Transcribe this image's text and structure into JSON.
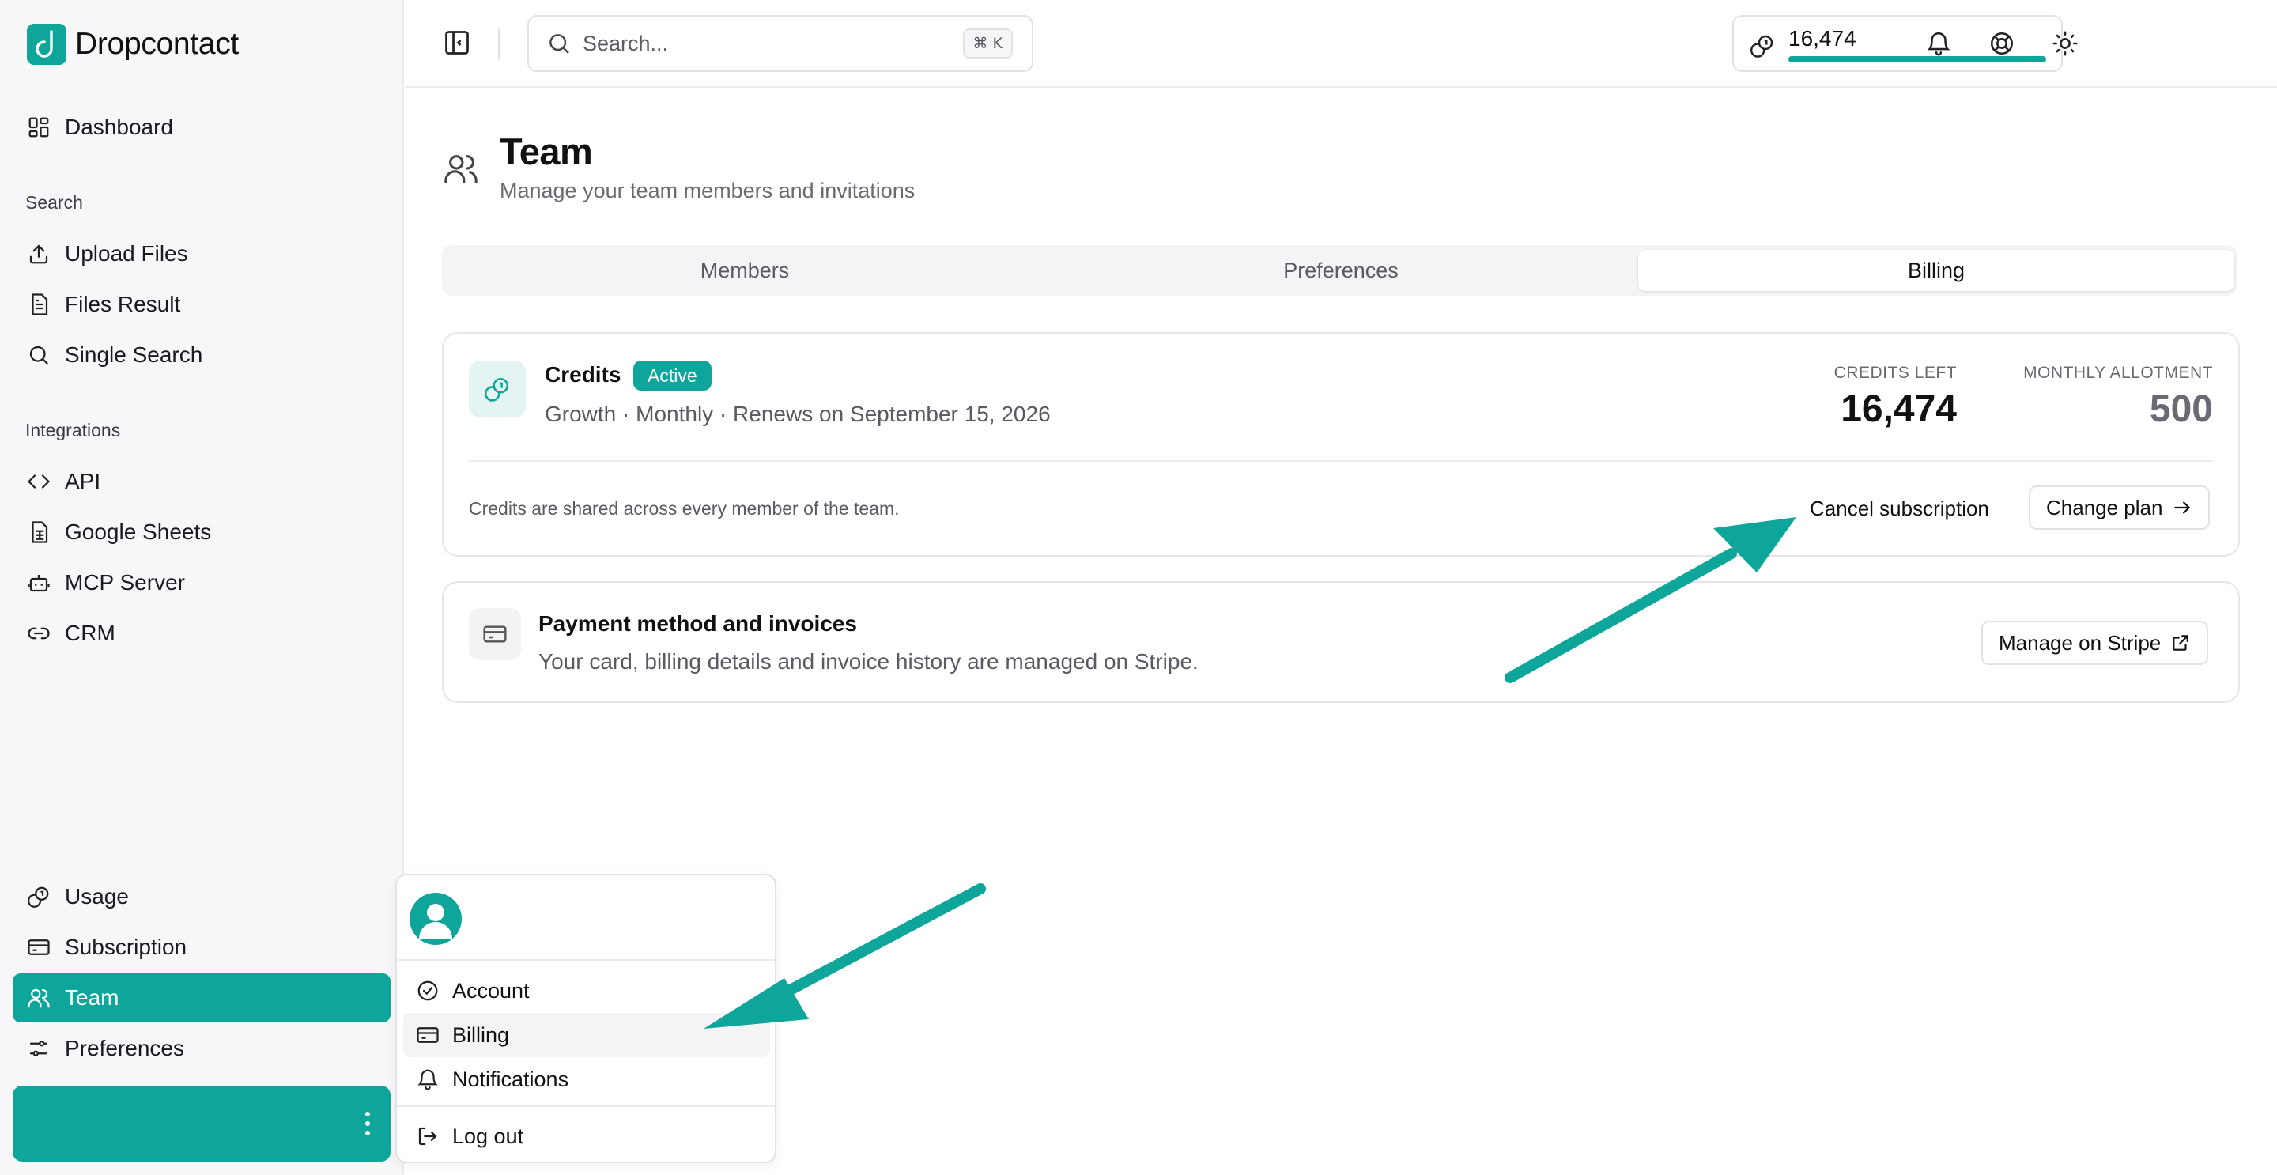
{
  "app": {
    "name": "Dropcontact"
  },
  "colors": {
    "accent": "#0ea59b",
    "accent_light": "#e3f4f2",
    "text": "#111114",
    "muted": "#5a5a64"
  },
  "sidebar": {
    "top_item": {
      "label": "Dashboard",
      "icon": "dashboard-icon"
    },
    "sections": [
      {
        "title": "Search",
        "items": [
          {
            "label": "Upload Files",
            "icon": "upload-icon"
          },
          {
            "label": "Files Result",
            "icon": "file-icon"
          },
          {
            "label": "Single Search",
            "icon": "search-icon"
          }
        ]
      },
      {
        "title": "Integrations",
        "items": [
          {
            "label": "API",
            "icon": "code-icon"
          },
          {
            "label": "Google Sheets",
            "icon": "spreadsheet-icon"
          },
          {
            "label": "MCP Server",
            "icon": "robot-icon"
          },
          {
            "label": "CRM",
            "icon": "link-icon"
          }
        ]
      }
    ],
    "bottom_items": [
      {
        "label": "Usage",
        "icon": "coins-icon"
      },
      {
        "label": "Subscription",
        "icon": "credit-card-icon"
      },
      {
        "label": "Team",
        "icon": "users-icon",
        "active": true
      },
      {
        "label": "Preferences",
        "icon": "sliders-icon"
      }
    ]
  },
  "topbar": {
    "search": {
      "placeholder": "Search...",
      "shortcut": "⌘ K"
    },
    "credits": {
      "value": "16,474",
      "fill_fraction": 1.0
    },
    "icons": [
      "bell-icon",
      "help-lifebuoy-icon",
      "sun-icon"
    ]
  },
  "page": {
    "title": "Team",
    "subtitle": "Manage your team members and invitations",
    "tabs": [
      {
        "label": "Members"
      },
      {
        "label": "Preferences"
      },
      {
        "label": "Billing",
        "active": true
      }
    ]
  },
  "credits_card": {
    "title": "Credits",
    "badge": "Active",
    "subtitle": "Growth · Monthly · Renews on September 15, 2026",
    "credits_left_label": "CREDITS LEFT",
    "credits_left_value": "16,474",
    "monthly_allotment_label": "MONTHLY ALLOTMENT",
    "monthly_allotment_value": "500",
    "note": "Credits are shared across every member of the team.",
    "cancel_label": "Cancel subscription",
    "change_plan_label": "Change plan"
  },
  "payment_card": {
    "title": "Payment method and invoices",
    "subtitle": "Your card, billing details and invoice history are managed on Stripe.",
    "manage_label": "Manage on Stripe"
  },
  "user_menu": {
    "items": [
      {
        "label": "Account",
        "icon": "badge-check-icon"
      },
      {
        "label": "Billing",
        "icon": "credit-card-icon",
        "highlighted": true
      },
      {
        "label": "Notifications",
        "icon": "bell-icon"
      }
    ],
    "logout_label": "Log out"
  }
}
